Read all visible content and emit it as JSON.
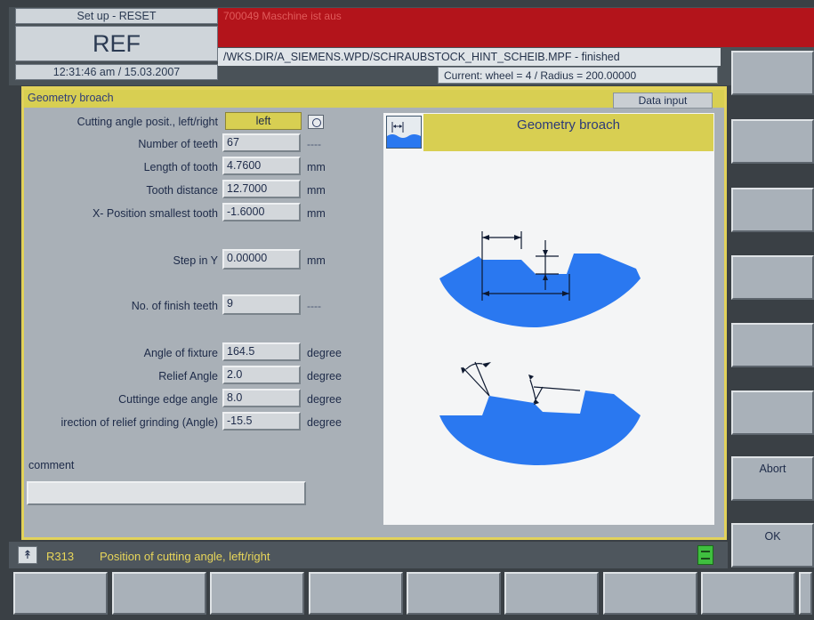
{
  "header": {
    "mode": "Set up - RESET",
    "ref": "REF",
    "datetime": "12:31:46 am / 15.03.2007",
    "alarm": "700049 Maschine ist aus",
    "program_path": "/WKS.DIR/A_SIEMENS.WPD/SCHRAUBSTOCK_HINT_SCHEIB.MPF - finished",
    "current": "Current:  wheel =  4   /  Radius =  200.00000"
  },
  "panel": {
    "title": "Geometry broach",
    "data_input": "Data input",
    "rows": [
      {
        "label": "Cutting angle posit., left/right",
        "value": "left",
        "unit": ""
      },
      {
        "label": "Number of teeth",
        "value": "67",
        "unit": "----"
      },
      {
        "label": "Length of tooth",
        "value": "4.7600",
        "unit": "mm"
      },
      {
        "label": "Tooth distance",
        "value": "12.7000",
        "unit": "mm"
      },
      {
        "label": "X- Position smallest tooth",
        "value": "-1.6000",
        "unit": "mm"
      },
      {
        "label": "Step in Y",
        "value": "0.00000",
        "unit": "mm"
      },
      {
        "label": "No. of finish teeth",
        "value": "9",
        "unit": "----"
      },
      {
        "label": "Angle of fixture",
        "value": "164.5",
        "unit": "degree"
      },
      {
        "label": "Relief Angle",
        "value": "2.0",
        "unit": "degree"
      },
      {
        "label": "Cuttinge edge angle",
        "value": "8.0",
        "unit": "degree"
      },
      {
        "label": "irection of relief grinding (Angle)",
        "value": "-15.5",
        "unit": "degree"
      }
    ],
    "comment_label": "comment",
    "comment_value": "",
    "graphic_title": "Geometry broach"
  },
  "softkeys_vertical": [
    "",
    "",
    "",
    "",
    "",
    "",
    "Abort",
    "OK"
  ],
  "status": {
    "code": "R313",
    "text": "Position of cutting angle, left/right"
  },
  "colors": {
    "accent_yellow": "#d8cf52",
    "alarm_red": "#b3141b",
    "broach_blue": "#2a78f0"
  }
}
